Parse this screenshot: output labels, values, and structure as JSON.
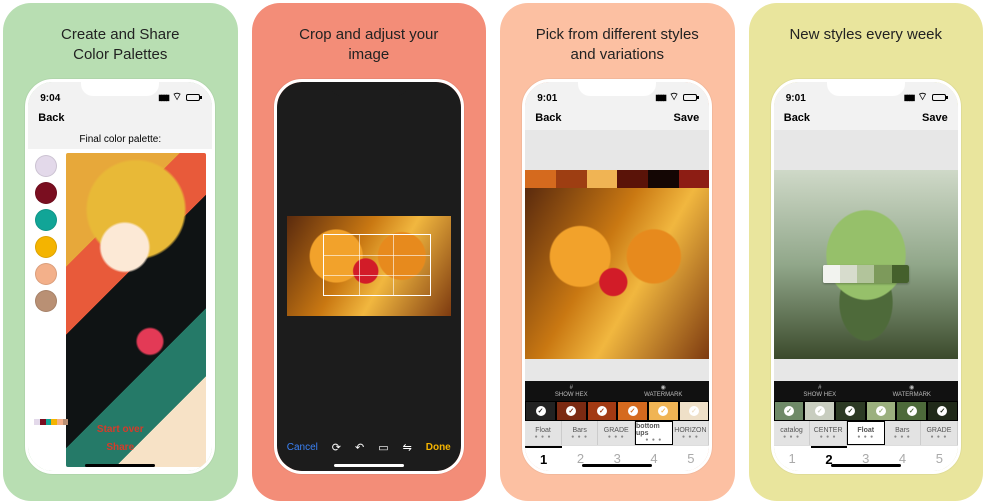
{
  "cards": [
    {
      "caption_l1": "Create and Share",
      "caption_l2": "Color Palettes",
      "bg": "#b8deb2"
    },
    {
      "caption_l1": "Crop and adjust your",
      "caption_l2": "image",
      "bg": "#f38d78"
    },
    {
      "caption_l1": "Pick from different styles",
      "caption_l2": "and variations",
      "bg": "#fcc0a2"
    },
    {
      "caption_l1": "New styles every week",
      "caption_l2": "",
      "bg": "#e9e59d"
    }
  ],
  "screen1": {
    "time": "9:04",
    "back": "Back",
    "title": "Final color palette:",
    "swatches": [
      "#e3d9ea",
      "#7a0e20",
      "#11a597",
      "#f4b400",
      "#f3b08a",
      "#b99074"
    ],
    "hexstrip": [
      "#e3d9ea",
      "#7a0e20",
      "#11a597",
      "#f4b400",
      "#f3b08a",
      "#b99074"
    ],
    "start_over": "Start over",
    "share": "Share"
  },
  "screen2": {
    "cancel": "Cancel",
    "done": "Done",
    "tool_icons": [
      "rotate-icon",
      "undo-icon",
      "aspect-icon",
      "mirror-icon"
    ]
  },
  "screen3": {
    "time": "9:01",
    "back": "Back",
    "save": "Save",
    "palette": [
      "#d56a1e",
      "#9e3e12",
      "#f0b454",
      "#5a1308",
      "#140604",
      "#8d1d14"
    ],
    "ctrl_head": {
      "left": "SHOW HEX",
      "right": "WATERMARK",
      "left_sym": "#",
      "right_sym": "◉"
    },
    "check_colors": [
      "#222",
      "#7b2a12",
      "#a23a13",
      "#d56a1e",
      "#f0b454",
      "#efe0c8"
    ],
    "styles": [
      "Float",
      "Bars",
      "GRADE",
      "bottom ups",
      "HORIZON"
    ],
    "style_selected_index": 3,
    "numbers": [
      "1",
      "2",
      "3",
      "4",
      "5"
    ],
    "number_selected_index": 0
  },
  "screen4": {
    "time": "9:01",
    "back": "Back",
    "save": "Save",
    "palette_float": [
      "#f2f3ef",
      "#d7dccd",
      "#b2c49b",
      "#7d9a5b",
      "#45602c"
    ],
    "ctrl_head": {
      "left": "SHOW HEX",
      "right": "WATERMARK",
      "left_sym": "#",
      "right_sym": "◉"
    },
    "check_colors": [
      "#6f8a68",
      "#c8cdbf",
      "#2c3a24",
      "#9bb07e",
      "#4d6a3a",
      "#202a19"
    ],
    "styles": [
      "catalog",
      "CENTER",
      "Float",
      "Bars",
      "GRADE"
    ],
    "style_selected_index": 2,
    "numbers": [
      "1",
      "2",
      "3",
      "4",
      "5"
    ],
    "number_selected_index": 1
  }
}
